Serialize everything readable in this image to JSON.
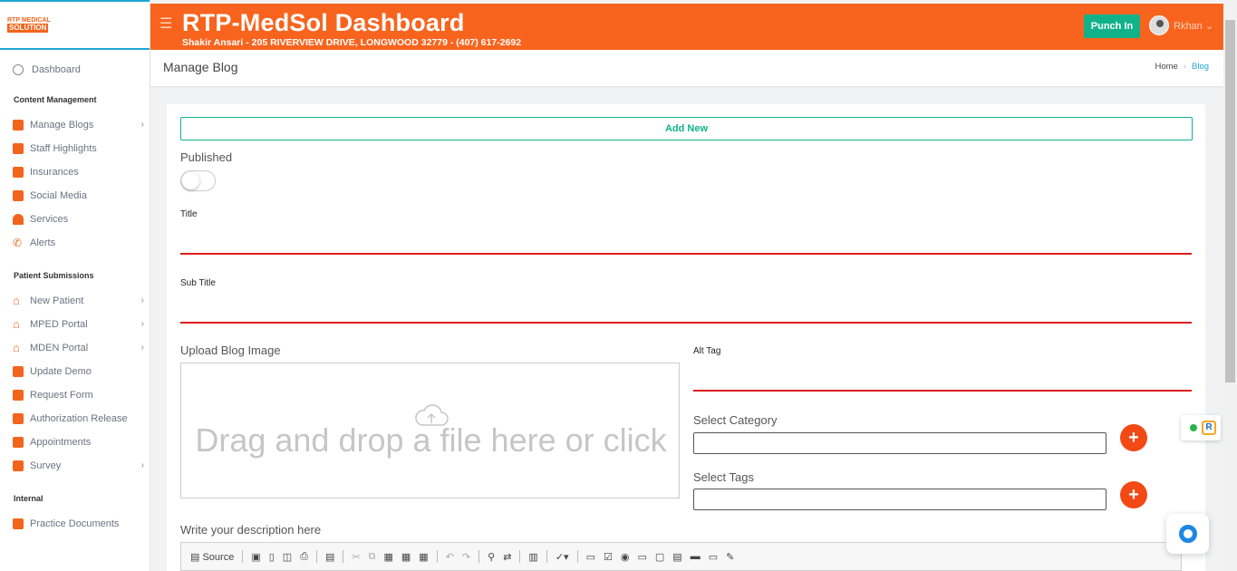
{
  "logo": {
    "line1": "RTP MEDICAL",
    "line2": "SOLUTION"
  },
  "header": {
    "title": "RTP-MedSol Dashboard",
    "subtitle": "Shakir Ansari - 205 RIVERVIEW DRIVE, LONGWOOD 32779 - (407) 617-2692",
    "punch_label": "Punch In",
    "user_name": "Rkhan"
  },
  "sidebar": {
    "dashboard": "Dashboard",
    "sections": [
      {
        "title": "Content Management",
        "items": [
          "Manage Blogs",
          "Staff Highlights",
          "Insurances",
          "Social Media",
          "Services",
          "Alerts"
        ]
      },
      {
        "title": "Patient Submissions",
        "items": [
          "New Patient",
          "MPED Portal",
          "MDEN Portal",
          "Update Demo",
          "Request Form",
          "Authorization Release",
          "Appointments",
          "Survey"
        ]
      },
      {
        "title": "Internal",
        "items": [
          "Practice Documents"
        ]
      }
    ]
  },
  "page": {
    "title": "Manage Blog",
    "breadcrumb": {
      "home": "Home",
      "current": "Blog"
    }
  },
  "form": {
    "add_new": "Add New",
    "published": "Published",
    "title_label": "Title",
    "subtitle_label": "Sub Title",
    "upload_label": "Upload Blog Image",
    "drop_text": "Drag and drop a file here or click",
    "alt_tag_label": "Alt Tag",
    "category_label": "Select Category",
    "tags_label": "Select Tags",
    "description_label": "Write your description here",
    "source_label": "Source"
  },
  "colors": {
    "brand": "#f8641e",
    "accent": "#11b28a",
    "link": "#1fa7d6",
    "underline": "#dc1e1e"
  }
}
